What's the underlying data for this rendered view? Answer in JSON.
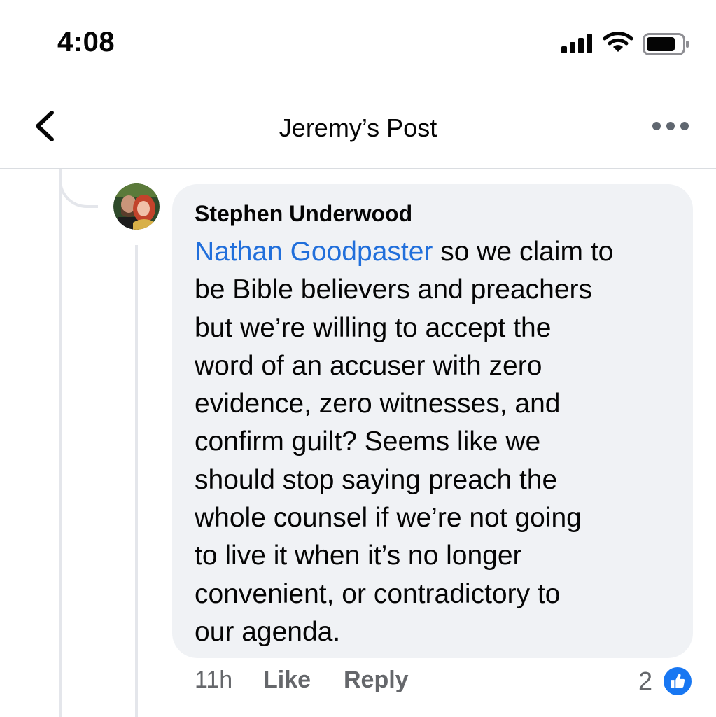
{
  "status_bar": {
    "time": "4:08"
  },
  "header": {
    "title": "Jeremy’s Post"
  },
  "comment": {
    "author": "Stephen Underwood",
    "mention": "Nathan Goodpaster",
    "body_lines": [
      " so we claim to",
      "be Bible believers and preachers",
      "but we’re willing to accept the",
      "word of an accuser with zero",
      "evidence, zero witnesses, and",
      "confirm guilt? Seems like we",
      "should stop saying preach the",
      "whole counsel if we’re not going",
      "to live it when it’s no longer",
      "convenient, or contradictory to",
      "our agenda."
    ],
    "timestamp": "11h",
    "like_label": "Like",
    "reply_label": "Reply",
    "reaction_count": "2"
  },
  "icons": {
    "back": "chevron-left-icon",
    "more": "more-horizontal-icon",
    "reaction": "thumbs-up-icon"
  },
  "colors": {
    "mention": "#216fdb",
    "bubble_bg": "#f0f2f5",
    "like_blue": "#1877f2",
    "muted_text": "#65676b"
  }
}
